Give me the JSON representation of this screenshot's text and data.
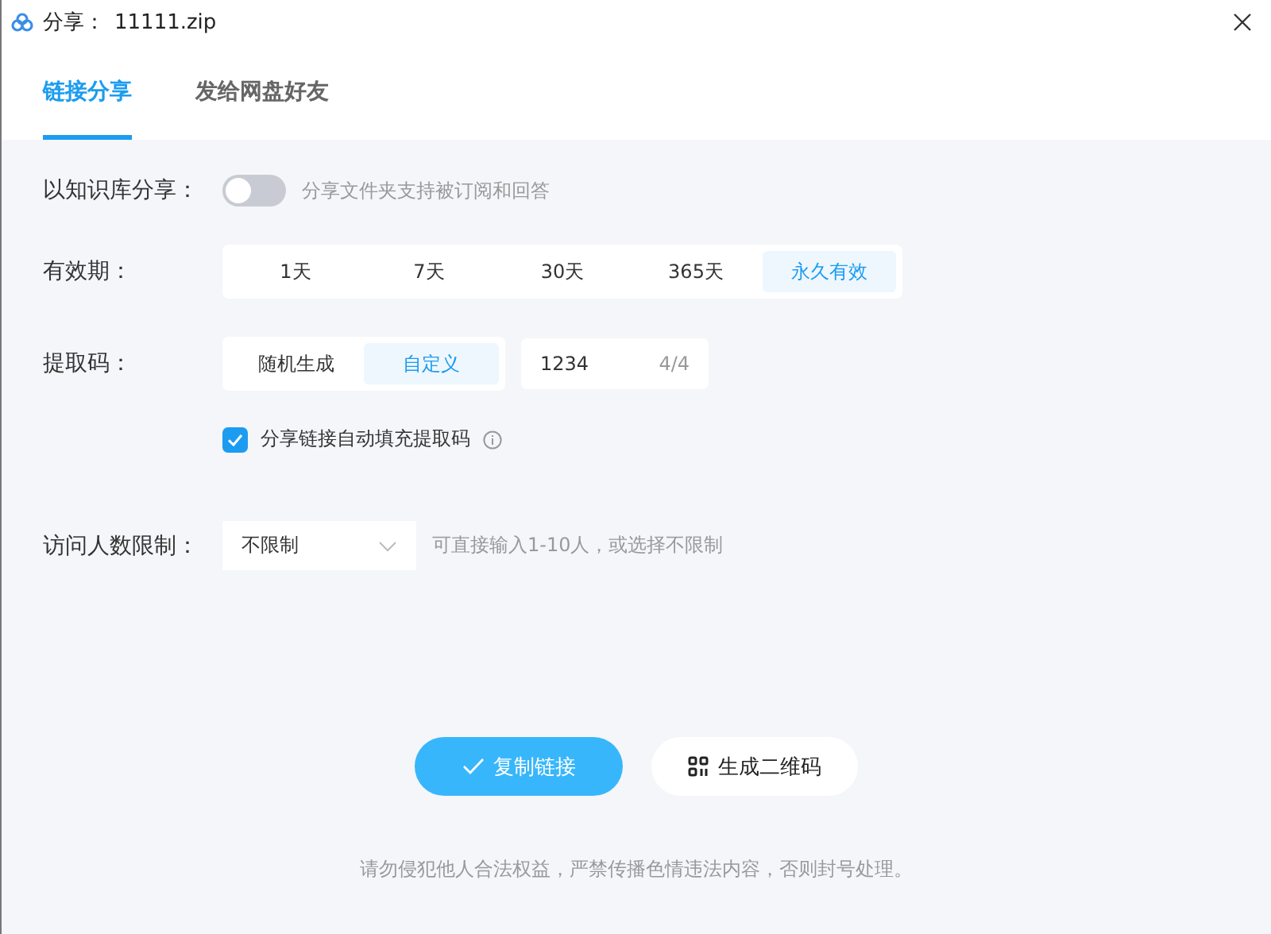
{
  "window": {
    "title": "分享：",
    "filename": "11111.zip"
  },
  "tabs": [
    {
      "label": "链接分享",
      "selected": true
    },
    {
      "label": "发给网盘好友",
      "selected": false
    }
  ],
  "knowledge": {
    "label": "以知识库分享：",
    "on": false,
    "hint": "分享文件夹支持被订阅和回答"
  },
  "validity": {
    "label": "有效期：",
    "options": [
      {
        "label": "1天",
        "selected": false
      },
      {
        "label": "7天",
        "selected": false
      },
      {
        "label": "30天",
        "selected": false
      },
      {
        "label": "365天",
        "selected": false
      },
      {
        "label": "永久有效",
        "selected": true
      }
    ]
  },
  "code": {
    "label": "提取码：",
    "options": [
      {
        "label": "随机生成",
        "selected": false
      },
      {
        "label": "自定义",
        "selected": true
      }
    ],
    "value": "1234",
    "counter": "4/4"
  },
  "autofill": {
    "label": "分享链接自动填充提取码",
    "checked": true
  },
  "limit": {
    "label": "访问人数限制：",
    "value": "不限制",
    "hint": "可直接输入1-10人，或选择不限制"
  },
  "buttons": [
    {
      "kind": "primary",
      "label": "复制链接"
    },
    {
      "kind": "qr",
      "label": "生成二维码"
    }
  ],
  "footer": "请勿侵犯他人合法权益，严禁传播色情违法内容，否则封号处理。"
}
